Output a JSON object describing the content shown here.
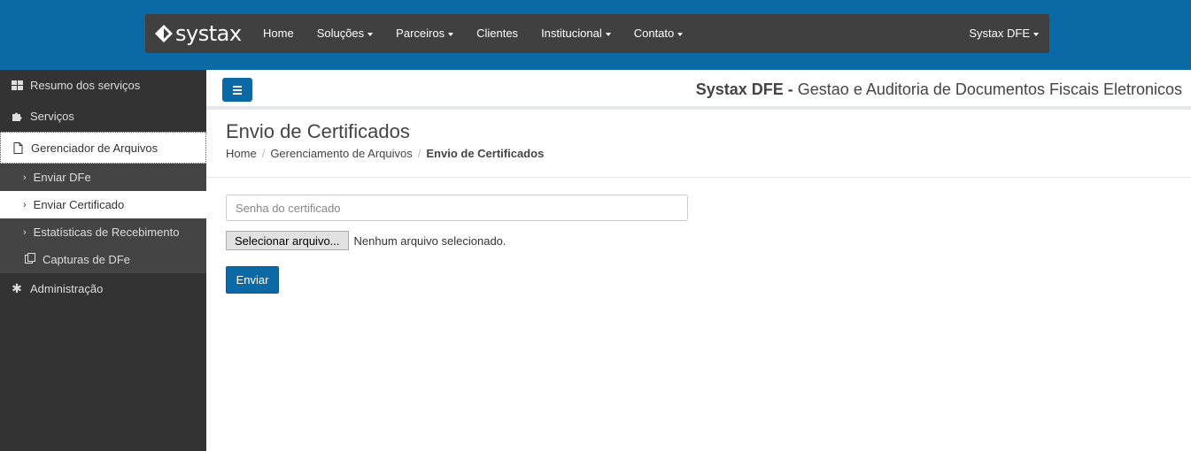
{
  "navbar": {
    "logo_text": "systax",
    "items": [
      {
        "label": "Home",
        "dropdown": false
      },
      {
        "label": "Soluções",
        "dropdown": true
      },
      {
        "label": "Parceiros",
        "dropdown": true
      },
      {
        "label": "Clientes",
        "dropdown": false
      },
      {
        "label": "Institucional",
        "dropdown": true
      },
      {
        "label": "Contato",
        "dropdown": true
      }
    ],
    "right_label": "Systax DFE"
  },
  "sidebar": {
    "items": [
      {
        "label": "Resumo dos serviços",
        "icon": "dashboard-icon"
      },
      {
        "label": "Serviços",
        "icon": "puzzle-icon"
      },
      {
        "label": "Gerenciador de Arquivos",
        "icon": "file-icon"
      },
      {
        "label": "Administração",
        "icon": "asterisk-icon"
      }
    ],
    "subitems": [
      {
        "label": "Enviar DFe",
        "icon": "chevron-right-icon"
      },
      {
        "label": "Enviar Certificado",
        "icon": "chevron-right-icon"
      },
      {
        "label": "Estatísticas de Recebimento",
        "icon": "chevron-right-icon"
      },
      {
        "label": "Capturas de DFe",
        "icon": "copy-icon"
      }
    ]
  },
  "header": {
    "title_bold": "Systax DFE -",
    "title_rest": " Gestao e Auditoria de Documentos Fiscais Eletronicos"
  },
  "page": {
    "title": "Envio de Certificados",
    "breadcrumb": [
      "Home",
      "Gerenciamento de Arquivos",
      "Envio de Certificados"
    ]
  },
  "form": {
    "password_placeholder": "Senha do certificado",
    "password_value": "",
    "file_button": "Selecionar arquivo...",
    "file_status": "Nenhum arquivo selecionado.",
    "submit_label": "Enviar"
  },
  "colors": {
    "brand_blue": "#0b6aa6",
    "navbar_bg": "#404040",
    "sidebar_bg": "#333333"
  }
}
